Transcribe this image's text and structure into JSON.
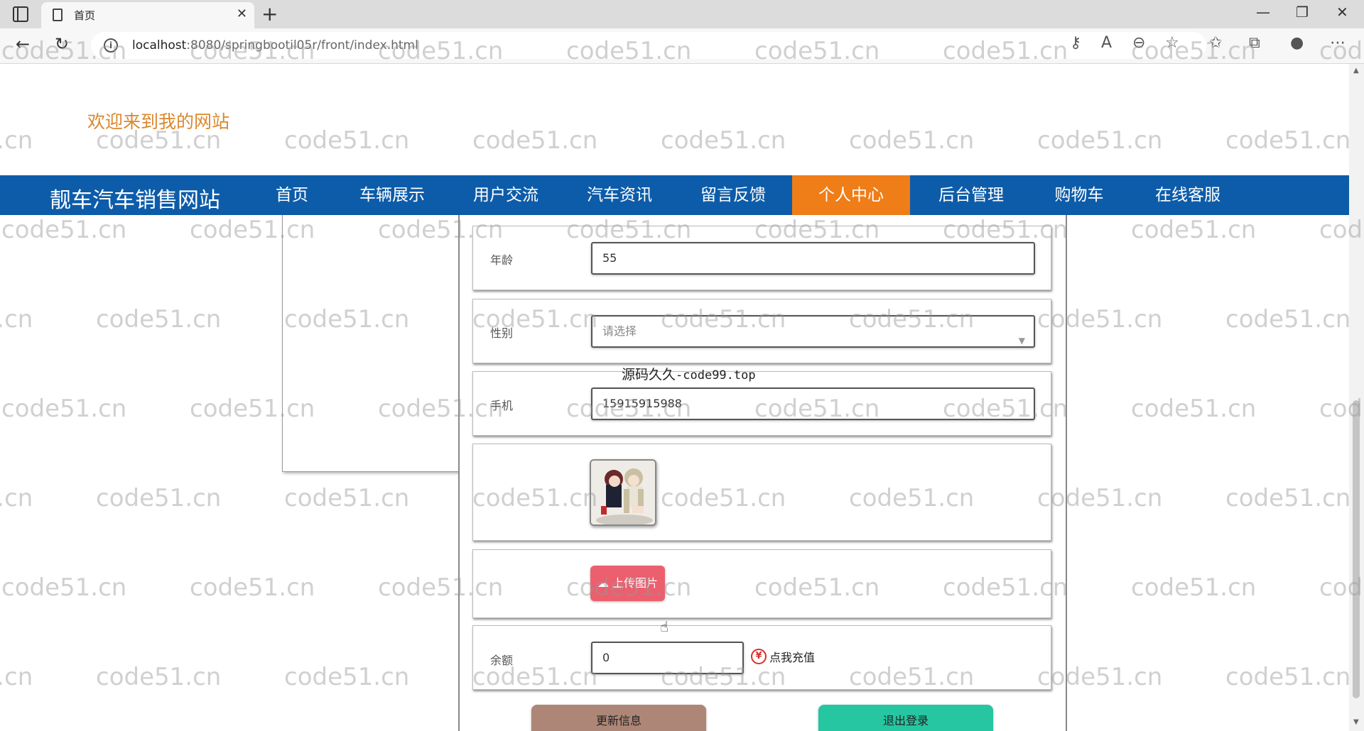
{
  "browser": {
    "tab_title": "首页",
    "tab_close": "✕",
    "new_tab": "+",
    "url_prefix": "localhost",
    "url_rest": ":8080/springbootil05r/front/index.html"
  },
  "header": {
    "welcome": "欢迎来到我的网站",
    "site_title": "靓车汽车销售网站"
  },
  "nav": {
    "items": [
      "首页",
      "车辆展示",
      "用户交流",
      "汽车资讯",
      "留言反馈",
      "个人中心",
      "后台管理",
      "购物车",
      "在线客服"
    ],
    "active_index": 5
  },
  "form": {
    "age_label": "年龄",
    "age_value": "55",
    "gender_label": "性别",
    "gender_placeholder": "请选择",
    "phone_label": "手机",
    "phone_value": "15915915988",
    "upload_label": "上传图片",
    "balance_label": "余额",
    "balance_value": "0",
    "recharge_label": "点我充值"
  },
  "overlay": {
    "text_cn": "源码久久",
    "text_en": "-code99.top"
  },
  "actions": {
    "update": "更新信息",
    "logout": "退出登录"
  },
  "watermark": "code51.cn",
  "colors": {
    "navbar": "#0d5ca9",
    "nav_active": "#ef7d18",
    "welcome": "#d9882e",
    "upload_button": "#ec5f6e",
    "update_button": "#ad8677",
    "logout_button": "#25c6a1"
  }
}
